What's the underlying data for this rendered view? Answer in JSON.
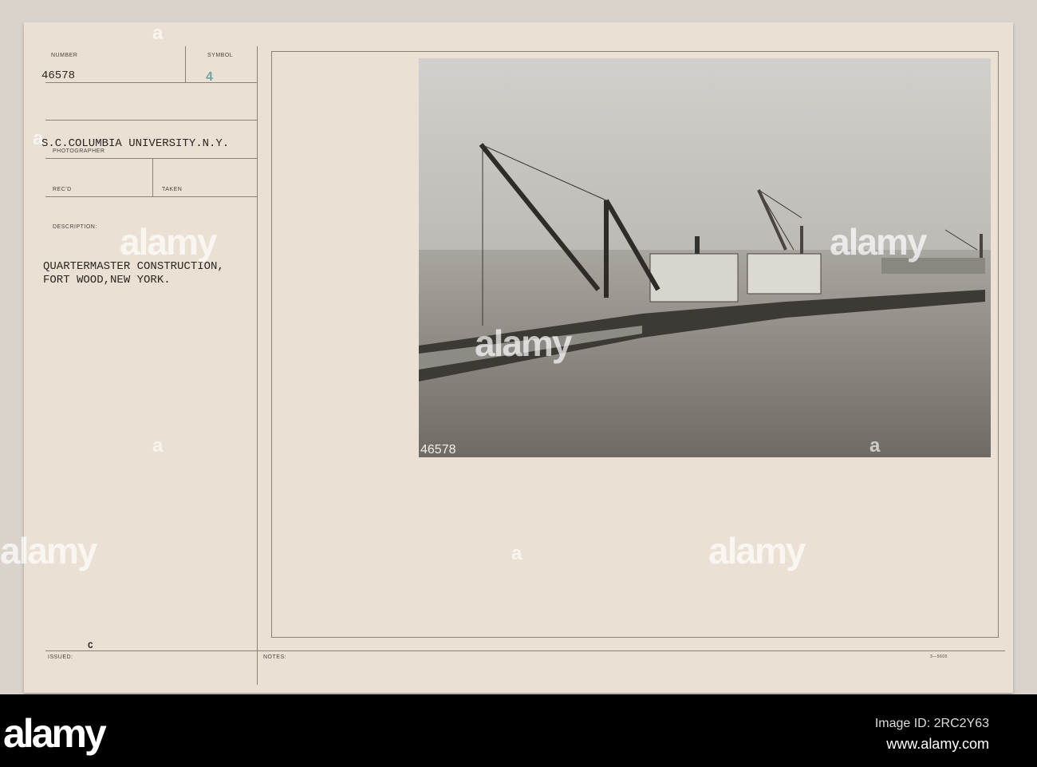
{
  "card": {
    "number_label": "NUMBER",
    "number": "46578",
    "symbol_label": "SYMBOL",
    "symbol": "4",
    "photographer": "S.C.COLUMBIA UNIVERSITY.N.Y.",
    "photographer_label": "PHOTOGRAPHER",
    "recd_label": "REC'D",
    "taken_label": "TAKEN",
    "description_label": "DESCRIPTION:",
    "description_line1": "QUARTERMASTER CONSTRUCTION,",
    "description_line2": "FORT WOOD,NEW YORK.",
    "issued_label": "ISSUED:",
    "issued": "C",
    "notes_label": "NOTES:",
    "form_number": "3—5605"
  },
  "photo": {
    "negative_number": "46578"
  },
  "watermark": {
    "text": "alamy",
    "letter": "a"
  },
  "footer": {
    "logo": "alamy",
    "image_id": "Image ID: 2RC2Y63",
    "url": "www.alamy.com"
  }
}
